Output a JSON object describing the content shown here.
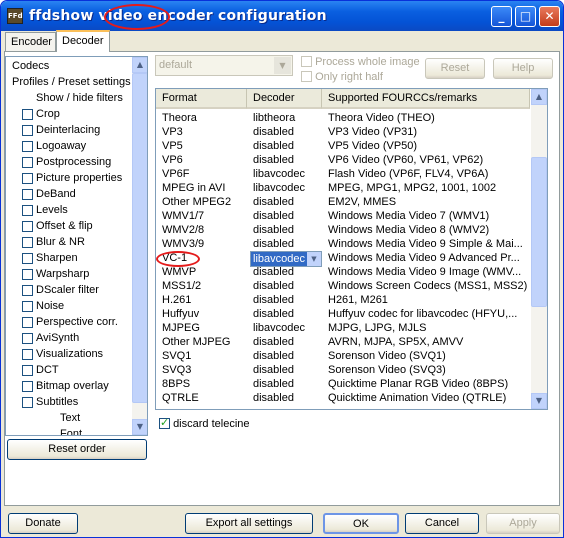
{
  "window": {
    "title": "ffdshow video encoder configuration",
    "title_prefix": "ffdshow video ",
    "title_highlight": "encoder",
    "title_suffix": " configuration",
    "icon_text": "FFd",
    "minimize_glyph": "_",
    "maximize_glyph": "□",
    "close_glyph": "✕"
  },
  "tabs": [
    {
      "label": "Encoder",
      "active": false
    },
    {
      "label": "Decoder",
      "active": true
    }
  ],
  "left_list": {
    "items": [
      {
        "label": "Codecs",
        "checkbox": false,
        "indent": 0
      },
      {
        "label": "Profiles / Preset settings",
        "checkbox": false,
        "indent": 1
      },
      {
        "label": "Show / hide filters",
        "checkbox": false,
        "indent": 2
      },
      {
        "label": "Crop",
        "checkbox": true,
        "checked": false
      },
      {
        "label": "Deinterlacing",
        "checkbox": true,
        "checked": false
      },
      {
        "label": "Logoaway",
        "checkbox": true,
        "checked": false
      },
      {
        "label": "Postprocessing",
        "checkbox": true,
        "checked": false
      },
      {
        "label": "Picture properties",
        "checkbox": true,
        "checked": false
      },
      {
        "label": "DeBand",
        "checkbox": true,
        "checked": false
      },
      {
        "label": "Levels",
        "checkbox": true,
        "checked": false
      },
      {
        "label": "Offset & flip",
        "checkbox": true,
        "checked": false
      },
      {
        "label": "Blur & NR",
        "checkbox": true,
        "checked": false
      },
      {
        "label": "Sharpen",
        "checkbox": true,
        "checked": false
      },
      {
        "label": "Warpsharp",
        "checkbox": true,
        "checked": false
      },
      {
        "label": "DScaler filter",
        "checkbox": true,
        "checked": false
      },
      {
        "label": "Noise",
        "checkbox": true,
        "checked": false
      },
      {
        "label": "Perspective corr.",
        "checkbox": true,
        "checked": false
      },
      {
        "label": "AviSynth",
        "checkbox": true,
        "checked": false
      },
      {
        "label": "Visualizations",
        "checkbox": true,
        "checked": false
      },
      {
        "label": "DCT",
        "checkbox": true,
        "checked": false
      },
      {
        "label": "Bitmap overlay",
        "checkbox": true,
        "checked": false
      },
      {
        "label": "Subtitles",
        "checkbox": true,
        "checked": false
      },
      {
        "label": "Text",
        "checkbox": false,
        "indent": 4
      },
      {
        "label": "Font",
        "checkbox": false,
        "indent": 4
      }
    ]
  },
  "reset_order_label": "Reset order",
  "preset_combo_value": "default",
  "process_whole_image_label": "Process whole image",
  "only_right_half_label": "Only right half",
  "reset_label": "Reset",
  "help_label": "Help",
  "grid": {
    "columns": [
      "Format",
      "Decoder",
      "Supported FOURCCs/remarks"
    ],
    "rows": [
      [
        "Theora",
        "libtheora",
        "Theora Video (THEO)"
      ],
      [
        "VP3",
        "disabled",
        "VP3 Video (VP31)"
      ],
      [
        "VP5",
        "disabled",
        "VP5 Video (VP50)"
      ],
      [
        "VP6",
        "disabled",
        "VP6 Video (VP60, VP61, VP62)"
      ],
      [
        "VP6F",
        "libavcodec",
        "Flash Video (VP6F, FLV4, VP6A)"
      ],
      [
        "MPEG in AVI",
        "libavcodec",
        "MPEG, MPG1, MPG2, 1001, 1002"
      ],
      [
        "Other MPEG2",
        "disabled",
        "EM2V, MMES"
      ],
      [
        "WMV1/7",
        "disabled",
        "Windows Media Video 7 (WMV1)"
      ],
      [
        "WMV2/8",
        "disabled",
        "Windows Media Video 8 (WMV2)"
      ],
      [
        "WMV3/9",
        "disabled",
        "Windows Media Video 9 Simple & Mai..."
      ],
      [
        "VC-1",
        "libavcodec",
        "Windows Media Video 9 Advanced Pr..."
      ],
      [
        "WMVP",
        "disabled",
        "Windows Media Video 9 Image (WMV..."
      ],
      [
        "MSS1/2",
        "disabled",
        "Windows Screen Codecs (MSS1, MSS2)"
      ],
      [
        "H.261",
        "disabled",
        "H261, M261"
      ],
      [
        "Huffyuv",
        "disabled",
        "Huffyuv codec for libavcodec (HFYU,..."
      ],
      [
        "MJPEG",
        "libavcodec",
        "MJPG, LJPG, MJLS"
      ],
      [
        "Other MJPEG",
        "disabled",
        "AVRN, MJPA, SP5X, AMVV"
      ],
      [
        "SVQ1",
        "disabled",
        "Sorenson Video (SVQ1)"
      ],
      [
        "SVQ3",
        "disabled",
        "Sorenson Video (SVQ3)"
      ],
      [
        "8BPS",
        "disabled",
        "Quicktime Planar RGB Video (8BPS)"
      ],
      [
        "QTRLE",
        "disabled",
        "Quicktime Animation Video (QTRLE)"
      ]
    ],
    "selected_row": 10
  },
  "discard_telecine_label": "discard telecine",
  "discard_telecine_checked": true,
  "bottom": {
    "donate": "Donate",
    "export": "Export all settings",
    "ok": "OK",
    "cancel": "Cancel",
    "apply": "Apply"
  },
  "colors": {
    "titlebar": "#0453d6",
    "annotation": "#e41b1b",
    "selection": "#316ac5"
  }
}
